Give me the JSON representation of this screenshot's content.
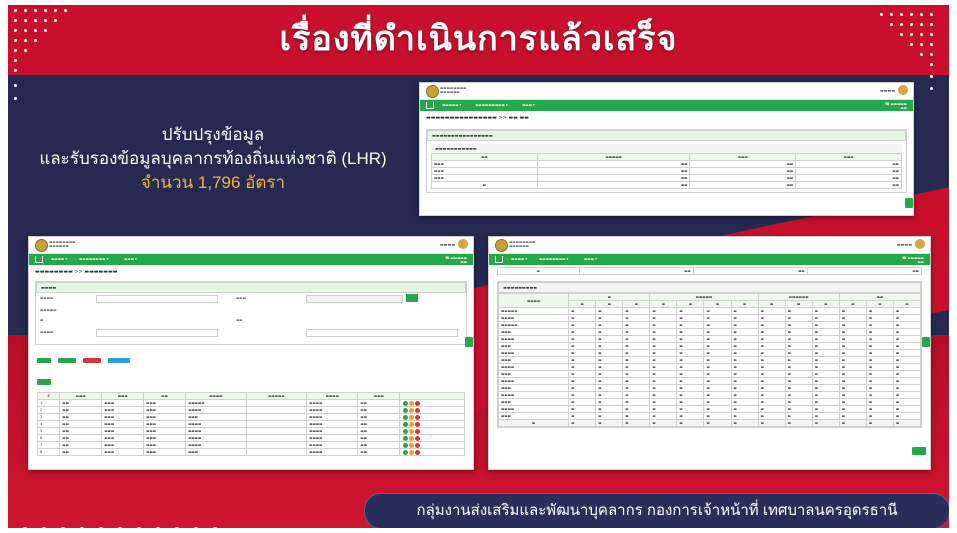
{
  "slide": {
    "title": "เรื่องที่ดำเนินการแล้วเสร็จ",
    "info_line1": "ปรับปรุงข้อมูล",
    "info_line2": "และรับรองข้อมูลบุคลากรท้องถิ่นแห่งชาติ (LHR)",
    "info_line3": "จำนวน  1,796 อัตรา",
    "footer": "กลุ่มงานส่งเสริมและพัฒนาบุคลากร กองการเจ้าหน้าที่ เทศบาลนครอุดรธานี"
  },
  "colors": {
    "red": "#c8102e",
    "navy": "#262a52",
    "accent_yellow": "#f4b63a",
    "green": "#25a84a"
  }
}
